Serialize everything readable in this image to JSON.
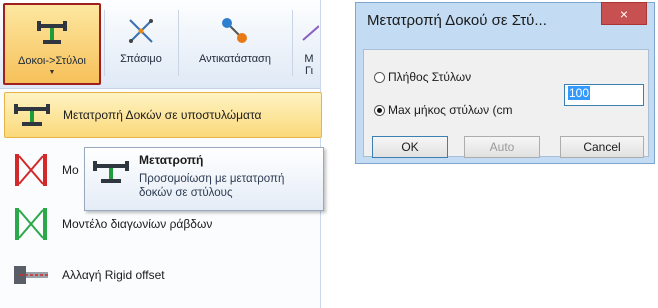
{
  "ribbon": {
    "buttons": [
      {
        "label": "Δοκοι->Στύλοι",
        "icon": "beam-to-column-icon"
      },
      {
        "label": "Σπάσιμο",
        "icon": "break-icon"
      },
      {
        "label": "Αντικατάσταση",
        "icon": "replace-icon"
      },
      {
        "label": "Μ\nΓι",
        "icon": "more-icon"
      }
    ],
    "beams_label_short": "Δοκοι->Στύλοι",
    "more_top": "Μ",
    "more_bottom": "Γι"
  },
  "menu": {
    "items": [
      {
        "label": "Μετατροπή Δοκών σε υποστυλώματα",
        "icon": "beam-to-column-icon"
      },
      {
        "label": "Μο",
        "icon": "cross-bracing-red-icon"
      },
      {
        "label": "Μοντέλο διαγωνίων ράβδων",
        "icon": "cross-bracing-green-icon"
      },
      {
        "label": "Αλλαγή Rigid offset",
        "icon": "rigid-offset-icon"
      }
    ]
  },
  "tooltip": {
    "title": "Μετατροπή",
    "line1": "Προσομοίωση με μετατροπή",
    "line2": "δοκών σε στύλους"
  },
  "dialog": {
    "title": "Μετατροπή Δοκού σε Στύ...",
    "close": "×",
    "option_count": "Πλήθος Στύλων",
    "option_length": "Max μήκος στύλων (cm",
    "length_value": "100",
    "ok": "OK",
    "auto": "Auto",
    "cancel": "Cancel"
  }
}
